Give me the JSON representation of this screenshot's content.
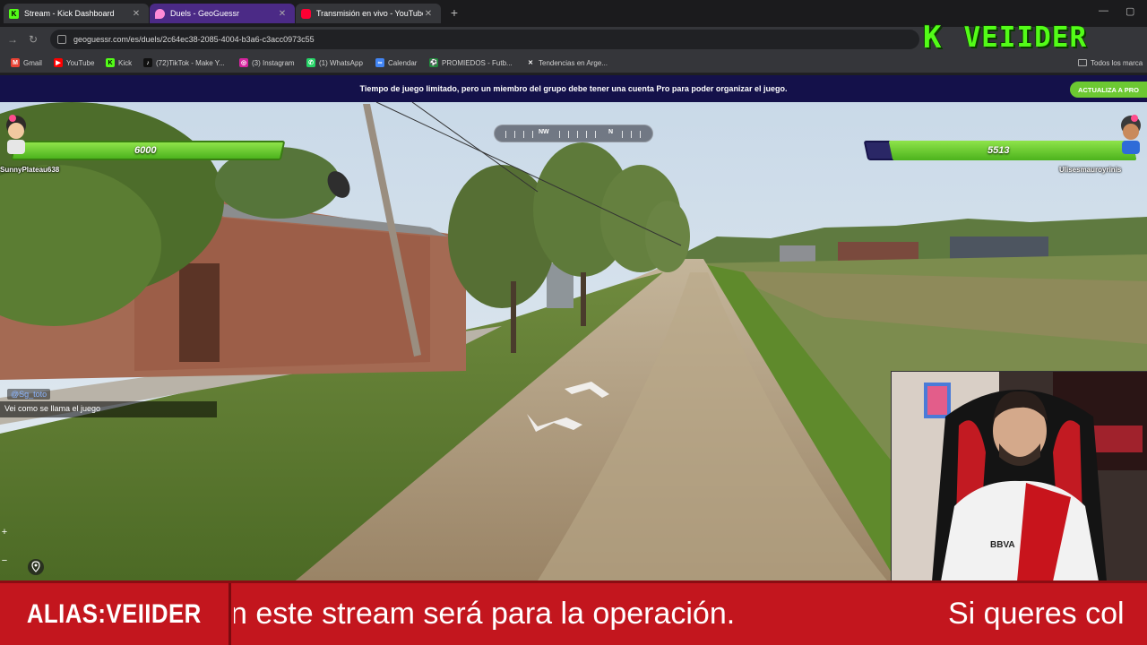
{
  "browser": {
    "tabs": [
      {
        "title": "Stream - Kick Dashboard",
        "icon": "kick-icon",
        "state": "inactive"
      },
      {
        "title": "Duels - GeoGuessr",
        "icon": "geoguessr-pin-icon",
        "state": "active"
      },
      {
        "title": "Transmisión en vivo - YouTube",
        "icon": "youtube-icon",
        "state": "inactive"
      }
    ],
    "new_tab_label": "+",
    "url": "geoguessr.com/es/duels/2c64ec38-2085-4004-b3a6-c3acc0973c55",
    "bookmarks": [
      {
        "label": "Gmail",
        "icon": "gmail-icon",
        "color": "#ea4335"
      },
      {
        "label": "YouTube",
        "icon": "youtube-icon",
        "color": "#ff0000"
      },
      {
        "label": "Kick",
        "icon": "kick-icon",
        "color": "#53fc18"
      },
      {
        "label": "(72)TikTok - Make Y...",
        "icon": "tiktok-icon",
        "color": "#111111"
      },
      {
        "label": "(3) Instagram",
        "icon": "instagram-icon",
        "color": "#d6249f"
      },
      {
        "label": "(1) WhatsApp",
        "icon": "whatsapp-icon",
        "color": "#25d366"
      },
      {
        "label": "Calendar",
        "icon": "calendar-icon",
        "color": "#4285f4"
      },
      {
        "label": "PROMIEDOS - Futb...",
        "icon": "promiedos-icon",
        "color": "#1f8a3a"
      },
      {
        "label": "Tendencias en Arge...",
        "icon": "x-icon",
        "color": "#222222"
      }
    ],
    "bookmarks_folder": "Todos los marca"
  },
  "banner": {
    "text": "Tiempo de juego limitado, pero un miembro del grupo debe tener una cuenta Pro para poder organizar el juego.",
    "upgrade_label": "ACTUALIZA A PRO"
  },
  "game": {
    "compass": {
      "labels": [
        "NW",
        "N"
      ]
    },
    "player_left": {
      "health": "6000",
      "health_fraction": 1.0,
      "name": "SunnyPlateau638"
    },
    "player_right": {
      "health": "5513",
      "health_fraction": 0.919,
      "name": "Ulisesmauroyrinis"
    }
  },
  "chat": {
    "user": "@Sg_toto",
    "message": "Vei como se llama el juego"
  },
  "overlay": {
    "logo_k": "K",
    "logo_word": "VEIIDER",
    "alias": "ALIAS:VEIIDER",
    "ticker_main": "n este stream será para la operación.",
    "ticker_next": "Si queres col"
  },
  "colors": {
    "kick_green": "#53fc18",
    "ticker_red": "#c3161e",
    "banner_navy": "#14114a",
    "health_green": "#6cc832"
  }
}
